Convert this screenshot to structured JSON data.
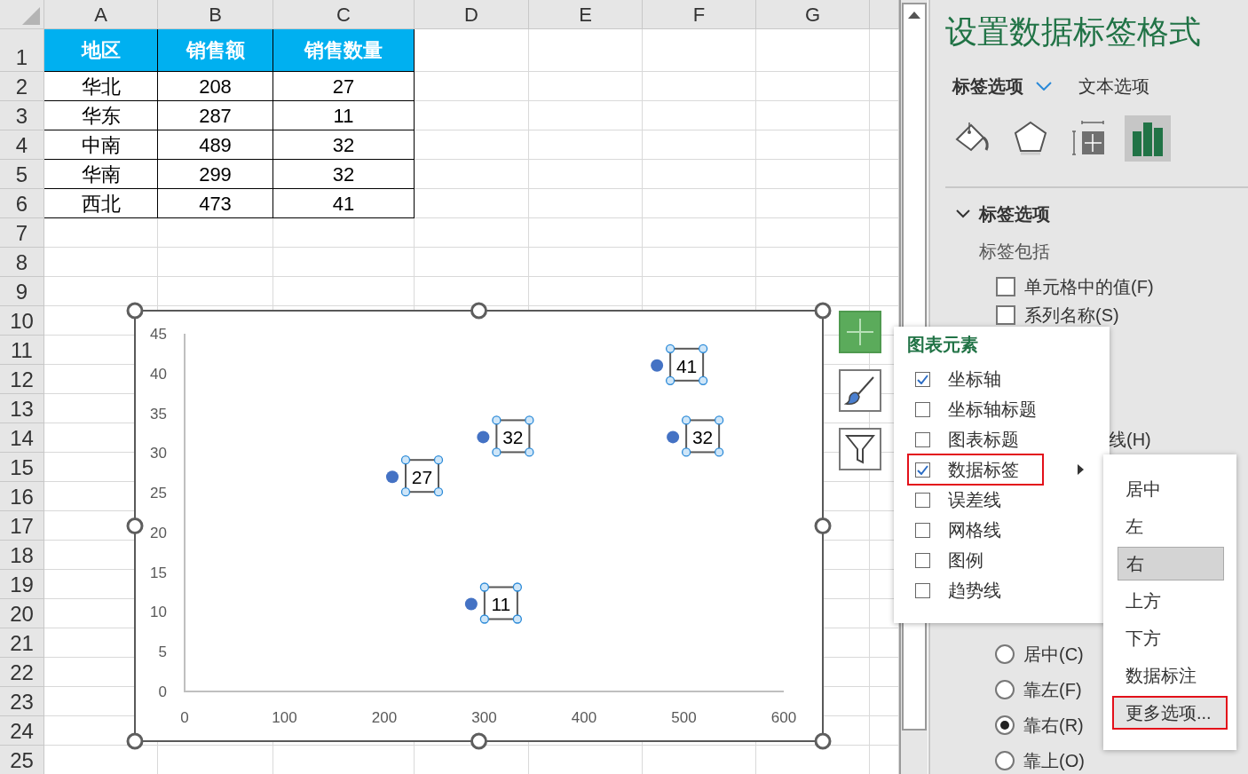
{
  "sheet": {
    "columns": [
      "A",
      "B",
      "C",
      "D",
      "E",
      "F",
      "G"
    ],
    "row_numbers": [
      "1",
      "2",
      "3",
      "4",
      "5",
      "6",
      "7",
      "8",
      "9",
      "10",
      "11",
      "12",
      "13",
      "14",
      "15",
      "16",
      "17",
      "18",
      "19",
      "20",
      "21",
      "22",
      "23",
      "24",
      "25"
    ],
    "table": {
      "header": [
        "地区",
        "销售额",
        "销售数量"
      ],
      "rows": [
        [
          "华北",
          "208",
          "27"
        ],
        [
          "华东",
          "287",
          "11"
        ],
        [
          "中南",
          "489",
          "32"
        ],
        [
          "华南",
          "299",
          "32"
        ],
        [
          "西北",
          "473",
          "41"
        ]
      ]
    }
  },
  "chart": {
    "chart_data": {
      "type": "scatter",
      "x": [
        208,
        287,
        489,
        299,
        473
      ],
      "series": [
        {
          "color": "#4472c4",
          "values": [
            27,
            11,
            32,
            32,
            41
          ]
        }
      ],
      "xlim": [
        0,
        600
      ],
      "ylim": [
        0,
        45
      ],
      "xticks": [
        0,
        100,
        200,
        300,
        400,
        500,
        600
      ],
      "yticks": [
        0,
        5,
        10,
        15,
        20,
        25,
        30,
        35,
        40,
        45
      ],
      "data_labels": true
    }
  },
  "chart_tools": [
    {
      "kind": "elements",
      "selected": true
    },
    {
      "kind": "styles",
      "selected": false
    },
    {
      "kind": "filter",
      "selected": false
    }
  ],
  "chart_elements_menu": {
    "title": "图表元素",
    "items": [
      {
        "label": "坐标轴",
        "checked": true,
        "highlighted": false,
        "has_submenu": false
      },
      {
        "label": "坐标轴标题",
        "checked": false,
        "highlighted": false,
        "has_submenu": false
      },
      {
        "label": "图表标题",
        "checked": false,
        "highlighted": false,
        "has_submenu": false
      },
      {
        "label": "数据标签",
        "checked": true,
        "highlighted": true,
        "has_submenu": true
      },
      {
        "label": "误差线",
        "checked": false,
        "highlighted": false,
        "has_submenu": false
      },
      {
        "label": "网格线",
        "checked": false,
        "highlighted": false,
        "has_submenu": false
      },
      {
        "label": "图例",
        "checked": false,
        "highlighted": false,
        "has_submenu": false
      },
      {
        "label": "趋势线",
        "checked": false,
        "highlighted": false,
        "has_submenu": false
      }
    ]
  },
  "label_position_menu": {
    "items": [
      {
        "label": "居中",
        "selected": false,
        "highlighted": false
      },
      {
        "label": "左",
        "selected": false,
        "highlighted": false
      },
      {
        "label": "右",
        "selected": true,
        "highlighted": false
      },
      {
        "label": "上方",
        "selected": false,
        "highlighted": false
      },
      {
        "label": "下方",
        "selected": false,
        "highlighted": false
      },
      {
        "label": "数据标注",
        "selected": false,
        "highlighted": false
      },
      {
        "label": "更多选项...",
        "selected": false,
        "highlighted": true
      }
    ]
  },
  "format_pane": {
    "title": "设置数据标签格式",
    "tabs": [
      {
        "label": "标签选项",
        "selected": true
      },
      {
        "label": "文本选项",
        "selected": false
      }
    ],
    "icon_tabs": [
      {
        "kind": "fill",
        "selected": false
      },
      {
        "kind": "effects",
        "selected": false
      },
      {
        "kind": "size",
        "selected": false
      },
      {
        "kind": "options",
        "selected": true
      }
    ],
    "section": {
      "title": "标签选项",
      "expanded": true,
      "subtitle": "标签包括",
      "checkboxes": [
        {
          "label": "单元格中的值(F)",
          "checked": false
        },
        {
          "label": "系列名称(S)",
          "checked": false
        }
      ],
      "partial_label": "线(H)",
      "radios": [
        {
          "label": "居中(C)",
          "selected": false
        },
        {
          "label": "靠左(F)",
          "selected": false
        },
        {
          "label": "靠右(R)",
          "selected": true
        },
        {
          "label": "靠上(O)",
          "selected": false
        }
      ]
    }
  }
}
